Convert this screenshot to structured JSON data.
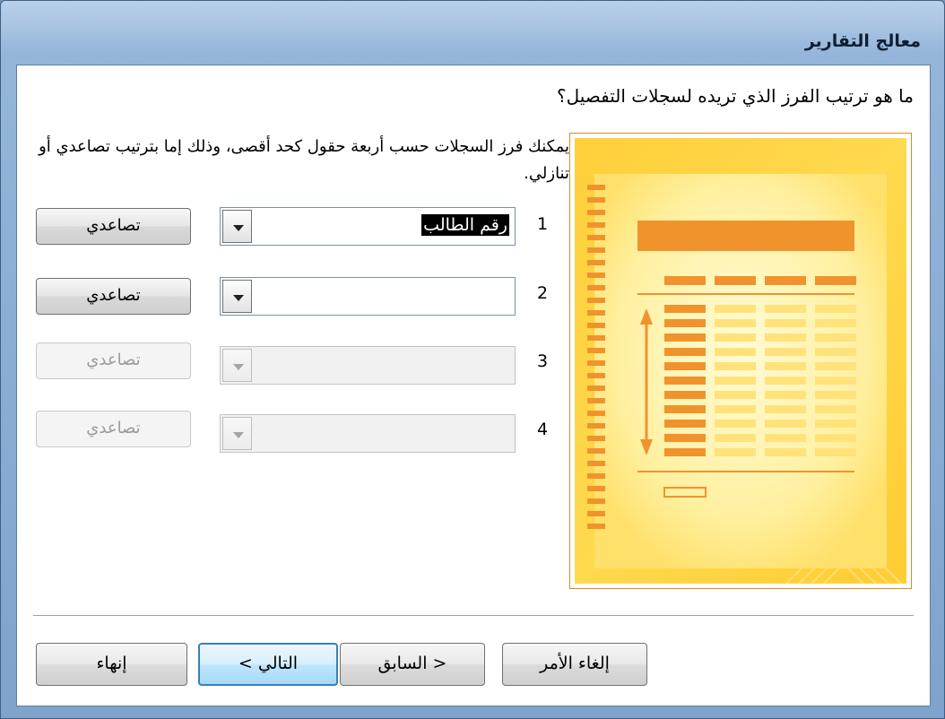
{
  "window": {
    "title": "معالج التقارير"
  },
  "wizard": {
    "question": "ما هو ترتيب الفرز الذي تريده لسجلات التفصيل؟",
    "description": "يمكنك فرز السجلات حسب أربعة حقول كحد أقصى، وذلك إما بترتيب تصاعدي أو تنازلي.",
    "sort_rows": [
      {
        "number": "1",
        "field_value": "رقم الطالب",
        "order_label": "تصاعدي",
        "enabled": true
      },
      {
        "number": "2",
        "field_value": "",
        "order_label": "تصاعدي",
        "enabled": true
      },
      {
        "number": "3",
        "field_value": "",
        "order_label": "تصاعدي",
        "enabled": false
      },
      {
        "number": "4",
        "field_value": "",
        "order_label": "تصاعدي",
        "enabled": false
      }
    ]
  },
  "buttons": {
    "finish": "إنهاء",
    "next": "التالي >",
    "back": "< السابق",
    "cancel": "إلغاء الأمر"
  },
  "colors": {
    "accent_orange": "#ee8f2b",
    "preview_yellow": "#ffd64a",
    "title_bar": "#a9c4e2"
  }
}
